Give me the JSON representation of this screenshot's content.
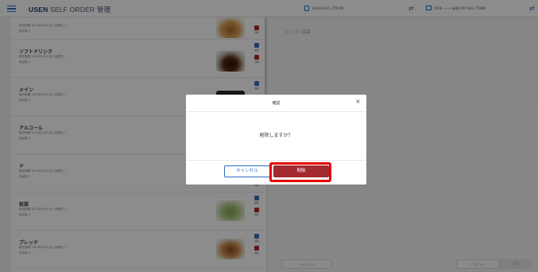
{
  "header": {
    "brand": "USEN",
    "brand_sub": "SELF ORDER 管理",
    "store_code": "A4912-U07_7T0-M0",
    "device_name": "0506 シート新規-U07-601-7T0M0"
  },
  "categories": [
    {
      "name": "",
      "meta1": "販売期間 2023年1月31日 (金曜日)~",
      "meta2": "商品数 4",
      "thumb": "food"
    },
    {
      "name": "ソフトドリンク",
      "meta1": "販売期間 2023年1月31日 (金曜日)~",
      "meta2": "商品数 4",
      "thumb": "drink"
    },
    {
      "name": "メイン",
      "meta1": "販売期間 2023年1月31日 (金曜日)~",
      "meta2": "商品数 5",
      "thumb": "dark"
    },
    {
      "name": "アルコール",
      "meta1": "販売期間 2023年1月31日 (金曜日)~",
      "meta2": "商品数 4",
      "thumb": "none"
    },
    {
      "name": "ド",
      "meta1": "販売期間 2023年1月31日 (金曜日)~",
      "meta2": "商品数 1",
      "thumb": "none"
    },
    {
      "name": "前菜",
      "meta1": "販売期間 2023年1月31日 (金曜日)~",
      "meta2": "商品数 3",
      "thumb": "salad"
    },
    {
      "name": "ブレッド",
      "meta1": "販売期間 2023年1月31日 (金曜日)~",
      "meta2": "商品数 4",
      "thumb": "bread"
    }
  ],
  "actions": {
    "edit_label": "編集",
    "delete_label": "削除"
  },
  "right_panel": {
    "title": "カテゴリ編集",
    "cancel_label": "キャンセル",
    "preview_label": "プレビュー",
    "save_label": "保存"
  },
  "dialog": {
    "title": "確認",
    "message": "削除しますか？",
    "cancel_label": "キャンセル",
    "delete_label": "削除"
  },
  "colors": {
    "accent": "#2a6fc2",
    "danger": "#a32a2e",
    "highlight": "#e50000"
  }
}
